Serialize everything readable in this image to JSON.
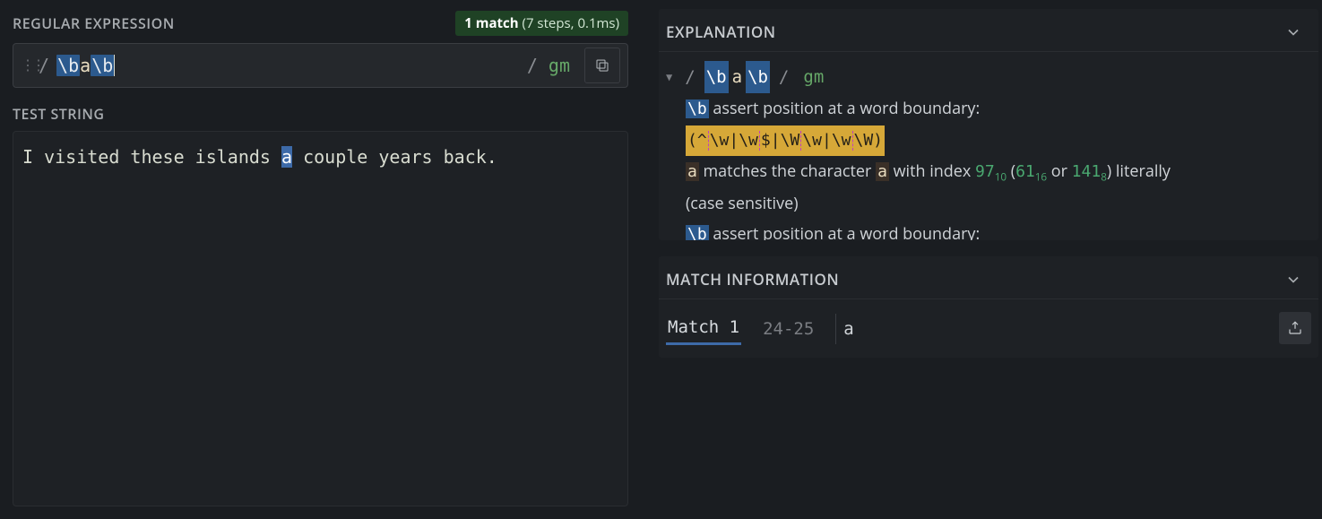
{
  "left": {
    "regex_header": "REGULAR EXPRESSION",
    "match_badge_strong": "1 match",
    "match_badge_detail": " (7 steps, 0.1ms)",
    "delimiter_open": "/",
    "delimiter_close": "/",
    "regex_tokens": {
      "t1": "\\b",
      "t2": "a",
      "t3": "\\b"
    },
    "flags": "gm",
    "test_header": "TEST STRING",
    "test_string_pre": "I visited these islands ",
    "test_string_match": "a",
    "test_string_post": " couple years back."
  },
  "right": {
    "explanation_header": "EXPLANATION",
    "exp": {
      "root_open": "/",
      "root_t1": "\\b",
      "root_t2": "a",
      "root_t3": "\\b",
      "root_close": "/",
      "root_flags": "gm",
      "line1_token": "\\b",
      "line1_text": " assert position at a word boundary:",
      "boundary_chars": {
        "a": "(^",
        "b": "\\w",
        "c": "|",
        "d": "\\w",
        "e": "$",
        "f": "|",
        "g": "\\W",
        "h": "\\w",
        "i": "|",
        "j": "\\w",
        "k": "\\W)"
      },
      "line3_char": "a",
      "line3_text_a": " matches the character ",
      "line3_text_b": " with index ",
      "idx_dec": "97",
      "idx_dec_base": "10",
      "idx_hex": "61",
      "idx_hex_base": "16",
      "idx_oct": "141",
      "idx_oct_base": "8",
      "line3_text_c": " (",
      "line3_text_d": " or ",
      "line3_text_e": ") literally",
      "line3_text_f": "(case sensitive)",
      "line4_token": "\\b",
      "line4_text": " assert position at a word boundary:"
    },
    "match_info_header": "MATCH INFORMATION",
    "match": {
      "label": "Match 1",
      "range": "24-25",
      "text": "a"
    }
  }
}
